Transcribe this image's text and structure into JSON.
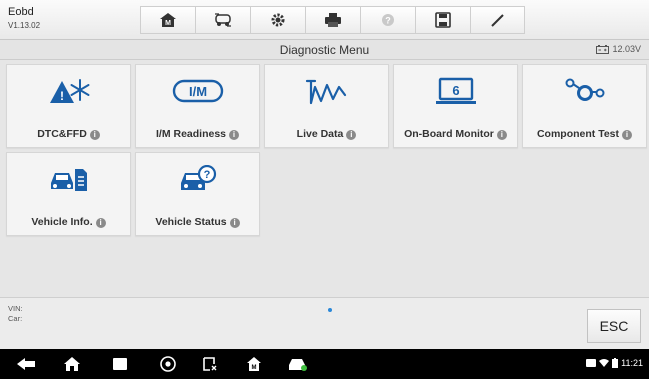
{
  "app": {
    "name": "Eobd",
    "version": "V1.13.02"
  },
  "toolbar": {
    "buttons": [
      {
        "icon": "home-icon"
      },
      {
        "icon": "vehicle-swap-icon"
      },
      {
        "icon": "gear-icon"
      },
      {
        "icon": "printer-icon"
      },
      {
        "icon": "help-icon"
      },
      {
        "icon": "save-icon"
      },
      {
        "icon": "edit-icon"
      }
    ]
  },
  "titlebar": {
    "title": "Diagnostic Menu",
    "voltage": "12.03V"
  },
  "menu": {
    "items": [
      {
        "label": "DTC&FFD",
        "icon": "warning-snowflake-icon"
      },
      {
        "label": "I/M Readiness",
        "icon": "im-icon"
      },
      {
        "label": "Live Data",
        "icon": "live-data-icon"
      },
      {
        "label": "On-Board Monitor",
        "icon": "monitor-icon"
      },
      {
        "label": "Component Test",
        "icon": "component-test-icon"
      },
      {
        "label": "Vehicle Info.",
        "icon": "vehicle-info-icon"
      },
      {
        "label": "Vehicle Status",
        "icon": "vehicle-status-icon"
      }
    ]
  },
  "info": {
    "vin_label": "VIN:",
    "car_label": "Car:"
  },
  "esc_label": "ESC",
  "statusbar": {
    "time": "11:21"
  },
  "colors": {
    "accent": "#1a5fa8",
    "info": "#8a8a8a",
    "page_dot": "#2b88d8"
  }
}
